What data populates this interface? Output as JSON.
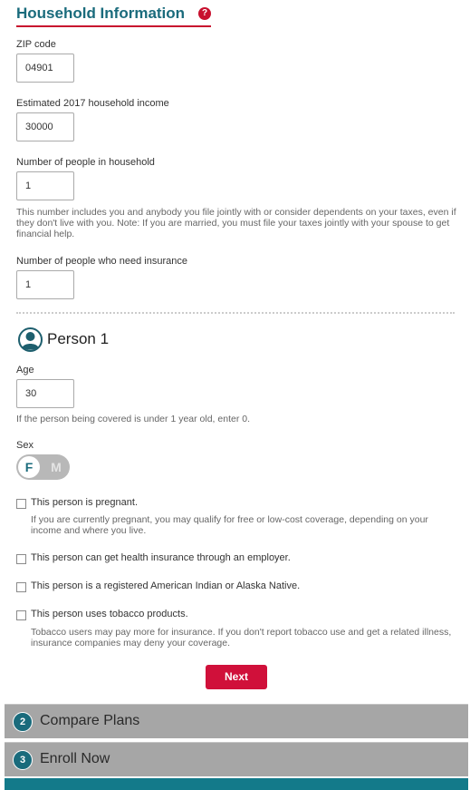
{
  "section": {
    "title": "Household Information",
    "help_icon": "?"
  },
  "household": {
    "zip": {
      "label": "ZIP code",
      "value": "04901"
    },
    "income": {
      "label": "Estimated 2017 household income",
      "value": "30000"
    },
    "people": {
      "label": "Number of people in household",
      "value": "1",
      "help": "This number includes you and anybody you file jointly with or consider dependents on your taxes, even if they don't live with you. Note: If you are married, you must file your taxes jointly with your spouse to get financial help."
    },
    "need_insurance": {
      "label": "Number of people who need insurance",
      "value": "1"
    }
  },
  "person": {
    "icon": "person-avatar-icon",
    "title": "Person 1",
    "age": {
      "label": "Age",
      "value": "30",
      "help": "If the person being covered is under 1 year old, enter 0."
    },
    "sex": {
      "label": "Sex",
      "female": "F",
      "male": "M",
      "selected": "F"
    },
    "checks": [
      {
        "label": "This person is pregnant.",
        "checked": false,
        "help": "If you are currently pregnant, you may qualify for free or low-cost coverage, depending on your income and where you live."
      },
      {
        "label": "This person can get health insurance through an employer.",
        "checked": false
      },
      {
        "label": "This person is a registered American Indian or Alaska Native.",
        "checked": false
      },
      {
        "label": "This person uses tobacco products.",
        "checked": false,
        "help": "Tobacco users may pay more for insurance. If you don't report tobacco use and get a related illness, insurance companies may deny your coverage."
      }
    ]
  },
  "actions": {
    "next": "Next"
  },
  "steps": [
    {
      "number": "2",
      "label": "Compare Plans"
    },
    {
      "number": "3",
      "label": "Enroll Now"
    }
  ],
  "colors": {
    "accent": "#1a6b7c",
    "primary_button": "#d0103a",
    "underline": "#c8102e",
    "step_bar": "#a6a6a6",
    "footer_band": "#137a8a"
  }
}
